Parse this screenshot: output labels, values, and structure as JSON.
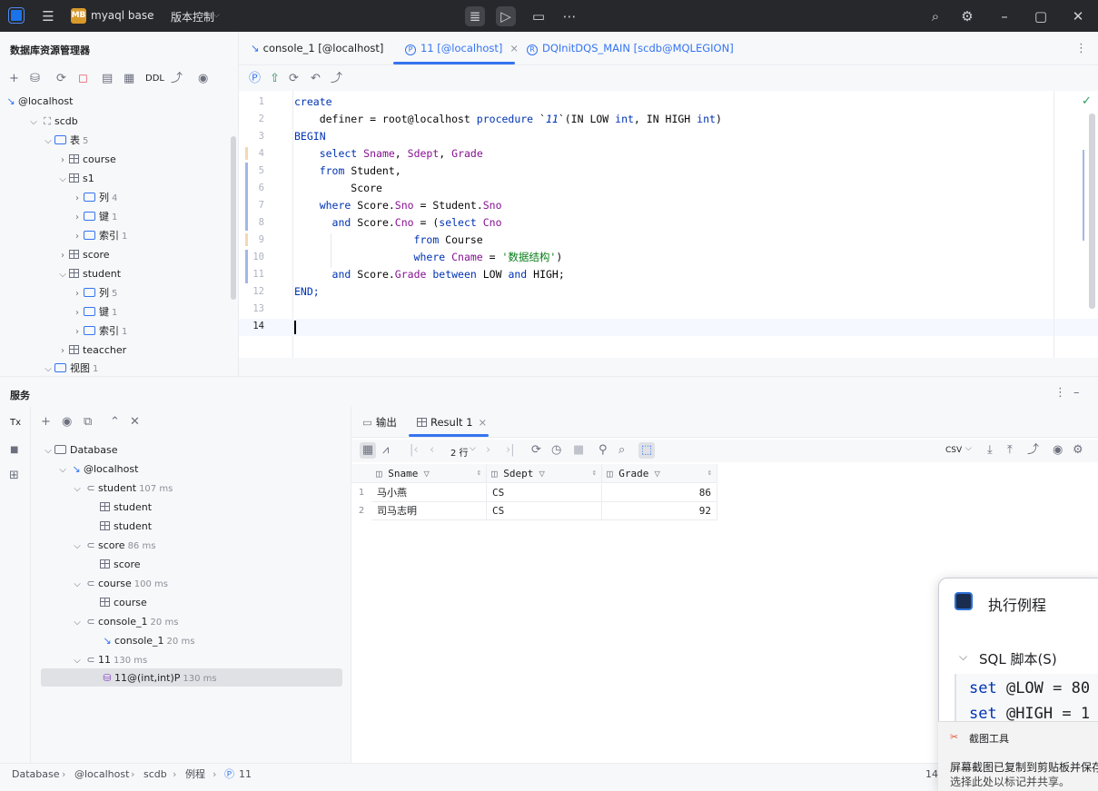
{
  "titlebar": {
    "project_badge": "MB",
    "project_name": "myaql base",
    "vcs": "版本控制",
    "icons": [
      "db-icon",
      "run-icon",
      "folder-icon",
      "more-icon",
      "search-icon",
      "gear-icon",
      "minimize-icon",
      "maximize-icon",
      "close-icon"
    ]
  },
  "explorer": {
    "title": "数据库资源管理器",
    "toolbar_ddl": "DDL",
    "tree": {
      "host": "@localhost",
      "schema": "scdb",
      "tables_label": "表",
      "tables_count": "5",
      "course": "course",
      "s1": "s1",
      "s1_cols": "列",
      "s1_cols_count": "4",
      "s1_keys": "键",
      "s1_keys_count": "1",
      "s1_idx": "索引",
      "s1_idx_count": "1",
      "score": "score",
      "student": "student",
      "st_cols": "列",
      "st_cols_count": "5",
      "st_keys": "键",
      "st_keys_count": "1",
      "st_idx": "索引",
      "st_idx_count": "1",
      "teaccher": "teaccher",
      "views_label": "视图",
      "views_count": "1"
    }
  },
  "tabs": [
    {
      "label": "console_1 [@localhost]"
    },
    {
      "label": "11 [@localhost]"
    },
    {
      "label": "DQInitDQS_MAIN [scdb@MQLEGION]"
    }
  ],
  "code": {
    "line_numbers": [
      "1",
      "2",
      "3",
      "4",
      "5",
      "6",
      "7",
      "8",
      "9",
      "10",
      "11",
      "12",
      "13",
      "14"
    ],
    "l1": "create",
    "l2_a": "    definer = root@localhost ",
    "l2_b": "procedure",
    "l2_c": " `",
    "l2_d": "11",
    "l2_e": "`(IN LOW ",
    "l2_f": "int",
    "l2_g": ", IN HIGH ",
    "l2_h": "int",
    "l2_i": ")",
    "l3": "BEGIN",
    "l4_a": "    select ",
    "l4_b": "Sname",
    "l4_c": ", ",
    "l4_d": "Sdept",
    "l4_e": ", ",
    "l4_f": "Grade",
    "l5_a": "    from ",
    "l5_b": "Student,",
    "l6": "         Score",
    "l7_a": "    where ",
    "l7_b": "Score.",
    "l7_c": "Sno",
    "l7_d": " = Student.",
    "l7_e": "Sno",
    "l8_a": "      and ",
    "l8_b": "Score.",
    "l8_c": "Cno",
    "l8_d": " = (",
    "l8_e": "select ",
    "l8_f": "Cno",
    "l9_a": "                   from ",
    "l9_b": "Course",
    "l10_a": "                   where ",
    "l10_b": "Cname",
    "l10_c": " = ",
    "l10_d": "'数据结构'",
    "l10_e": ")",
    "l11_a": "      and ",
    "l11_b": "Score.",
    "l11_c": "Grade",
    "l11_d": " between ",
    "l11_e": "LOW ",
    "l11_f": "and",
    "l11_g": " HIGH;",
    "l12": "END;"
  },
  "services": {
    "title": "服务",
    "tx_label": "Tx",
    "tree": {
      "database": "Database",
      "host": "@localhost",
      "student_sess": "student",
      "student_sess_ms": "107 ms",
      "student_t1": "student",
      "student_t2": "student",
      "score_sess": "score",
      "score_sess_ms": "86 ms",
      "score_t": "score",
      "course_sess": "course",
      "course_sess_ms": "100 ms",
      "course_t": "course",
      "console_sess": "console_1",
      "console_sess_ms": "20 ms",
      "console_t": "console_1",
      "console_t_ms": "20 ms",
      "p11_sess": "11",
      "p11_sess_ms": "130 ms",
      "p11_t": "11@(int,int)P",
      "p11_t_ms": "130 ms"
    }
  },
  "result": {
    "tab_output": "输出",
    "tab_result": "Result 1",
    "rows_label": "2 行",
    "export_format": "CSV",
    "columns": [
      "Sname",
      "Sdept",
      "Grade"
    ],
    "rows": [
      {
        "n": "1",
        "sname": "马小燕",
        "sdept": "CS",
        "grade": "86"
      },
      {
        "n": "2",
        "sname": "司马志明",
        "sdept": "CS",
        "grade": "92"
      }
    ]
  },
  "popup": {
    "title": "执行例程",
    "section": "SQL 脚本(S)",
    "code_l1_kw": "set",
    "code_l1_rest": " @LOW = 80",
    "code_l2_kw": "set",
    "code_l2_rest": " @HIGH = 1",
    "notif_title": "截图工具",
    "notif_l1": "屏幕截图已复制到剪贴板并保存",
    "notif_l2": "选择此处以标记并共享。"
  },
  "statusbar": {
    "crumbs": [
      "Database",
      "@localhost",
      "scdb",
      "例程",
      "11"
    ],
    "right": "14:"
  },
  "colors": {
    "accent": "#3574f0",
    "keyword": "#0033b3",
    "field": "#871094",
    "string": "#067d17",
    "titlebar": "#27282c"
  }
}
